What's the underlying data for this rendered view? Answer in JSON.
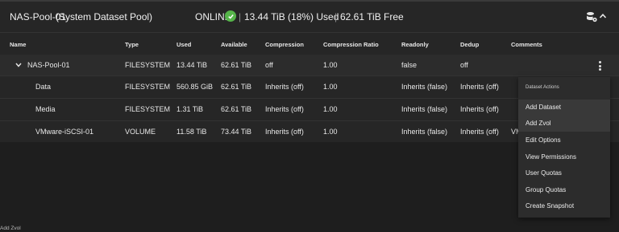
{
  "pool": {
    "name": "NAS-Pool-01",
    "description": "(System Dataset Pool)",
    "status": "ONLINE",
    "used": "13.44 TiB (18%) Used",
    "free": "62.61 TiB Free",
    "separator": "|"
  },
  "table": {
    "headers": [
      "Name",
      "Type",
      "Used",
      "Available",
      "Compression",
      "Compression Ratio",
      "Readonly",
      "Dedup",
      "Comments"
    ],
    "rows": [
      {
        "name": "NAS-Pool-01",
        "type": "FILESYSTEM",
        "used": "13.44 TiB",
        "available": "62.61 TiB",
        "compression": "off",
        "ratio": "1.00",
        "readonly": "false",
        "dedup": "off",
        "comments": ""
      },
      {
        "name": "Data",
        "type": "FILESYSTEM",
        "used": "560.85 GiB",
        "available": "62.61 TiB",
        "compression": "Inherits (off)",
        "ratio": "1.00",
        "readonly": "Inherits (false)",
        "dedup": "Inherits (off)",
        "comments": ""
      },
      {
        "name": "Media",
        "type": "FILESYSTEM",
        "used": "1.31 TiB",
        "available": "62.61 TiB",
        "compression": "Inherits (off)",
        "ratio": "1.00",
        "readonly": "Inherits (false)",
        "dedup": "Inherits (off)",
        "comments": ""
      },
      {
        "name": "VMware-iSCSI-01",
        "type": "VOLUME",
        "used": "11.58 TiB",
        "available": "73.44 TiB",
        "compression": "Inherits (off)",
        "ratio": "1.00",
        "readonly": "Inherits (false)",
        "dedup": "Inherits (off)",
        "comments": "VM"
      }
    ]
  },
  "menu": {
    "heading": "Dataset Actions",
    "items": [
      "Add Dataset",
      "Add Zvol",
      "Edit Options",
      "View Permissions",
      "User Quotas",
      "Group Quotas",
      "Create Snapshot"
    ]
  },
  "footer": {
    "hover_text": "Add Zvol"
  },
  "colors": {
    "background": "#1e1e1e",
    "panel": "#262626",
    "online": "#56b54a",
    "menu": "#2c2c2c"
  },
  "icons": [
    "check-circle-icon",
    "database-settings-icon",
    "chevron-up-icon",
    "chevron-down-icon",
    "more-vert-icon"
  ]
}
